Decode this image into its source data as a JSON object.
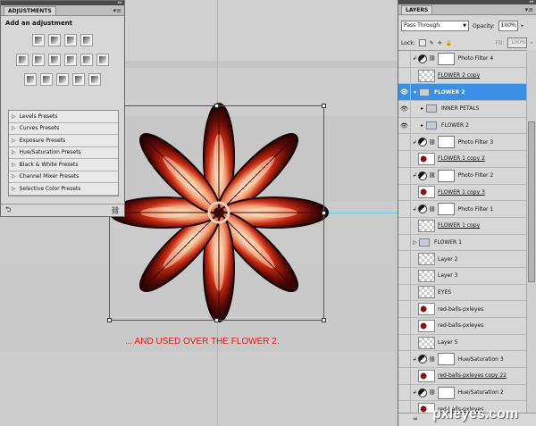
{
  "adjustments_panel": {
    "tab": "ADJUSTMENTS",
    "collapse_glyph": "◂◂",
    "close_glyph": "✕",
    "menu_glyph": "▾≡",
    "heading": "Add an adjustment",
    "icon_rows": [
      [
        "brightness-contrast-icon",
        "levels-icon",
        "curves-icon",
        "exposure-icon"
      ],
      [
        "vibrance-icon",
        "hue-saturation-icon",
        "color-balance-icon",
        "black-white-icon",
        "photo-filter-icon",
        "channel-mixer-icon"
      ],
      [
        "invert-icon",
        "posterize-icon",
        "threshold-icon",
        "gradient-map-icon",
        "selective-color-icon"
      ]
    ],
    "presets": [
      "Levels Presets",
      "Curves Presets",
      "Exposure Presets",
      "Hue/Saturation Presets",
      "Black & White Presets",
      "Channel Mixer Presets",
      "Selective Color Presets"
    ],
    "footer_left_icon": "return-icon",
    "footer_right_icon": "clip-icon"
  },
  "canvas": {
    "caption": "... AND USED OVER THE FLOWER 2.",
    "caption_color": "#e81515",
    "guide_color": "#5fd8e8"
  },
  "layers_panel": {
    "tab": "LAYERS",
    "collapse_glyph": "◂◂",
    "close_glyph": "✕",
    "menu_glyph": "▾≡",
    "blend_mode": "Pass Through",
    "opacity_label": "Opacity:",
    "opacity_value": "100%",
    "lock_label": "Lock:",
    "fill_label": "Fill:",
    "fill_value": "100%",
    "selected_color": "#3a8fe6",
    "layers": [
      {
        "name": "Photo Filter 4",
        "kind": "adjustment",
        "visible": false,
        "clip": true
      },
      {
        "name": "FLOWER 2 copy",
        "kind": "pixel",
        "visible": false,
        "thumb": "checker",
        "underline": true
      },
      {
        "name": "FLOWER 2",
        "kind": "group-open",
        "visible": true,
        "selected": true
      },
      {
        "name": "INNER PETALS",
        "kind": "group-child",
        "visible": true
      },
      {
        "name": "FLOWER 2",
        "kind": "group-child",
        "visible": true
      },
      {
        "name": "Photo Filter 3",
        "kind": "adjustment",
        "visible": false,
        "clip": true
      },
      {
        "name": "FLOWER 1 copy 2",
        "kind": "pixel",
        "visible": false,
        "thumb": "red",
        "underline": true
      },
      {
        "name": "Photo Filter 2",
        "kind": "adjustment",
        "visible": false,
        "clip": true
      },
      {
        "name": "FLOWER 1 copy 3",
        "kind": "pixel",
        "visible": false,
        "thumb": "red",
        "underline": true
      },
      {
        "name": "Photo Filter 1",
        "kind": "adjustment",
        "visible": false,
        "clip": true
      },
      {
        "name": "FLOWER 1 copy",
        "kind": "pixel",
        "visible": false,
        "thumb": "checker",
        "underline": true
      },
      {
        "name": "FLOWER 1",
        "kind": "group",
        "visible": false
      },
      {
        "name": "Layer 2",
        "kind": "pixel",
        "visible": false,
        "thumb": "checker"
      },
      {
        "name": "Layer 3",
        "kind": "pixel",
        "visible": false,
        "thumb": "checker"
      },
      {
        "name": "EYES",
        "kind": "pixel",
        "visible": false,
        "thumb": "checker"
      },
      {
        "name": "red-balls-pxleyes",
        "kind": "pixel",
        "visible": false,
        "thumb": "red"
      },
      {
        "name": "red-balls-pxleyes",
        "kind": "pixel",
        "visible": false,
        "thumb": "red"
      },
      {
        "name": "Layer 5",
        "kind": "pixel",
        "visible": false,
        "thumb": "checker"
      },
      {
        "name": "Hue/Saturation 3",
        "kind": "adjustment",
        "visible": false,
        "clip": true
      },
      {
        "name": "red-balls-pxleyes copy 22",
        "kind": "pixel",
        "visible": false,
        "thumb": "red",
        "underline": true
      },
      {
        "name": "Hue/Saturation 2",
        "kind": "adjustment",
        "visible": false,
        "clip": true
      },
      {
        "name": "red-balls-pxleyes",
        "kind": "pixel",
        "visible": false,
        "thumb": "red",
        "underline": true
      }
    ],
    "footer_glyph": "∞"
  },
  "watermark": "pxleyes.com"
}
